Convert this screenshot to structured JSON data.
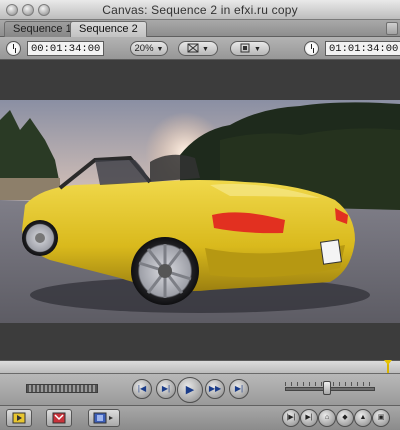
{
  "window": {
    "title": "Canvas: Sequence 2 in efxi.ru copy"
  },
  "tabs": [
    {
      "label": "Sequence 1",
      "active": false
    },
    {
      "label": "Sequence 2",
      "active": true
    }
  ],
  "controls": {
    "duration_timecode": "00:01:34:00",
    "zoom_value": "20%",
    "current_timecode": "01:01:34:00"
  },
  "colors": {
    "playhead": "#d8b400",
    "car_body": "#e0c21c",
    "transport_icons": "#1a3c8a",
    "tail_light": "#e23020"
  },
  "icons": {
    "timecode_clock": "clock-icon",
    "view_options": "view-options-icon",
    "overlay_options": "overlay-options-icon",
    "play": "play-icon",
    "mark_in": "mark-in-icon",
    "mark_out": "mark-out-icon",
    "insert_edit": "insert-edit-icon",
    "overwrite_edit": "overwrite-edit-icon",
    "replace_edit": "replace-edit-icon"
  },
  "transport": {
    "playhead_position": 0.97,
    "jog_position": 0.47
  }
}
